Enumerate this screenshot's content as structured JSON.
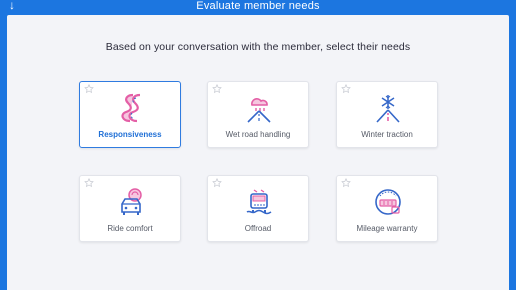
{
  "header": {
    "title": "Evaluate member needs",
    "back_icon": "arrow-down-icon"
  },
  "prompt": "Based on your conversation with the member, select their needs",
  "colors": {
    "accent": "#1c76e0",
    "selected_border": "#2f7be0",
    "icon_pink": "#e45fa6",
    "icon_blue": "#3567c9"
  },
  "needs": [
    {
      "label": "Responsiveness",
      "icon": "winding-road-icon",
      "selected": true
    },
    {
      "label": "Wet road handling",
      "icon": "rain-cloud-road-icon",
      "selected": false
    },
    {
      "label": "Winter traction",
      "icon": "snowflake-road-icon",
      "selected": false
    },
    {
      "label": "Ride comfort",
      "icon": "car-comfort-icon",
      "selected": false
    },
    {
      "label": "Offroad",
      "icon": "offroad-vehicle-icon",
      "selected": false
    },
    {
      "label": "Mileage warranty",
      "icon": "odometer-icon",
      "selected": false
    }
  ]
}
